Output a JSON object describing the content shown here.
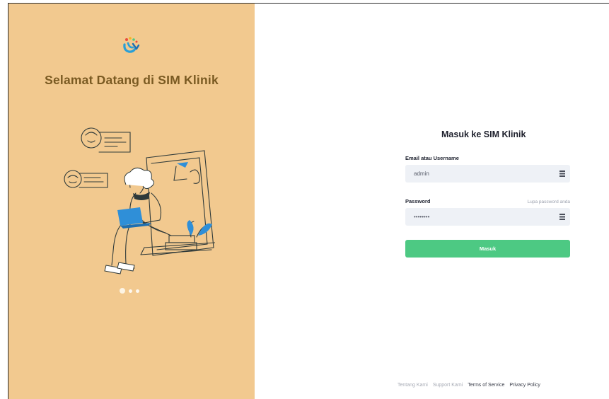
{
  "welcome": {
    "title": "Selamat Datang di SIM Klinik"
  },
  "carousel": {
    "slide_count": 3,
    "active_index": 0
  },
  "login": {
    "title": "Masuk ke SIM Klinik",
    "username_label": "Email atau Username",
    "username_value": "admin",
    "password_label": "Password",
    "password_value": "••••••••",
    "forgot_link": "Lupa password anda",
    "submit_label": "Masuk"
  },
  "footer": {
    "about": "Tentang Kami",
    "support": "Support Kami",
    "terms": "Terms of Service",
    "privacy": "Privacy Policy"
  },
  "icons": {
    "logo": "clinic-logo-icon",
    "username_field": "list-icon",
    "password_field": "list-icon"
  },
  "colors": {
    "left_panel_bg": "#f2c98f",
    "title_color": "#7a5a22",
    "primary_button": "#4dc983",
    "input_bg": "#eef1f6"
  }
}
